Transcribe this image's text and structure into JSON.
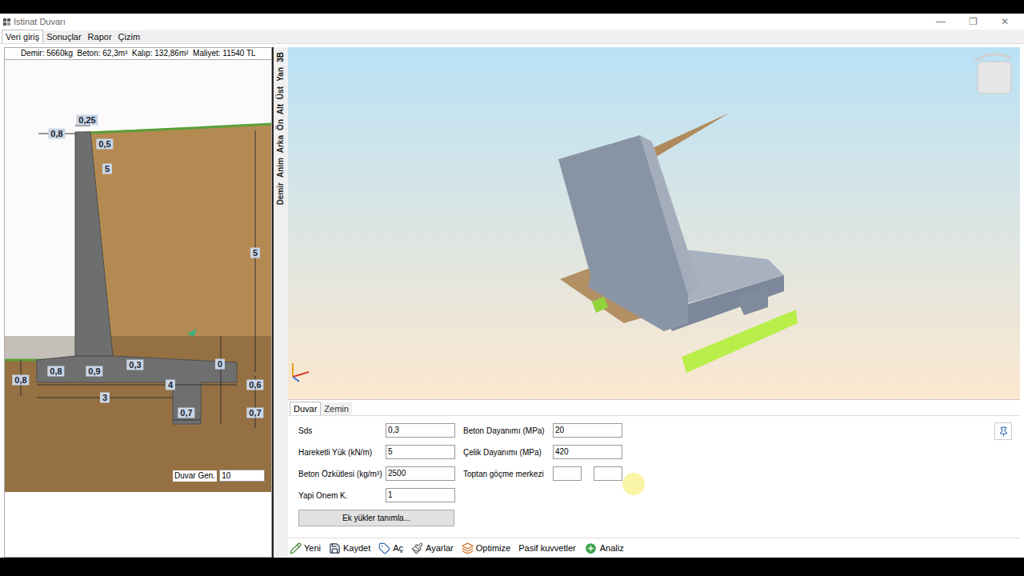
{
  "window": {
    "title": "Istinat Duvarı",
    "controls": [
      "—",
      "❐",
      "✕"
    ]
  },
  "menu_tabs": [
    {
      "label": "Veri giriş",
      "selected": true
    },
    {
      "label": "Sonuçlar",
      "selected": false
    },
    {
      "label": "Rapor",
      "selected": false
    },
    {
      "label": "Çizim",
      "selected": false
    }
  ],
  "summary": "Demir: 5660kg  Beton: 62,3m³  Kalıp: 132,86m²  Maliyet: 11540 TL",
  "drawing": {
    "dimensions": [
      "0,25",
      "0,8",
      "0,5",
      "5",
      "5",
      "0,3",
      "0",
      "0,8",
      "0,8",
      "0,9",
      "4",
      "0,6",
      "3",
      "0,7",
      "0,7"
    ],
    "width_field": {
      "label": "Duvar Gen.",
      "value": "10"
    }
  },
  "view_tabs": [
    {
      "label": "3B",
      "selected": true
    },
    {
      "label": "Yan",
      "selected": false
    },
    {
      "label": "Üst",
      "selected": false
    },
    {
      "label": "Alt",
      "selected": false
    },
    {
      "label": "Ön",
      "selected": false
    },
    {
      "label": "Arka",
      "selected": false
    },
    {
      "label": "Anim",
      "selected": false
    },
    {
      "label": "Demir",
      "selected": false
    }
  ],
  "form_tabs": [
    {
      "label": "Duvar",
      "selected": true
    },
    {
      "label": "Zemin",
      "selected": false
    }
  ],
  "fields_left": [
    {
      "label": "Sds",
      "value": "0,3"
    },
    {
      "label": "Hareketli Yük (kN/m)",
      "value": "5"
    },
    {
      "label": "Beton Özkütlesi (kg/m³)",
      "value": "2500"
    },
    {
      "label": "Yapi Onem K.",
      "value": "1"
    }
  ],
  "fields_right": [
    {
      "label": "Beton Dayanımı (MPa)",
      "value": "20"
    },
    {
      "label": "Çelik Dayanımı (MPa)",
      "value": "420"
    }
  ],
  "collapse_center": {
    "label": "Toptan göçme merkezi",
    "values": [
      "",
      ""
    ]
  },
  "extra_button": "Ek yükler tanımla...",
  "toolbar": [
    "Yeni",
    "Kaydet",
    "Aç",
    "Ayarlar",
    "Optimize",
    "Pasif kuvvetler",
    "Analiz"
  ]
}
